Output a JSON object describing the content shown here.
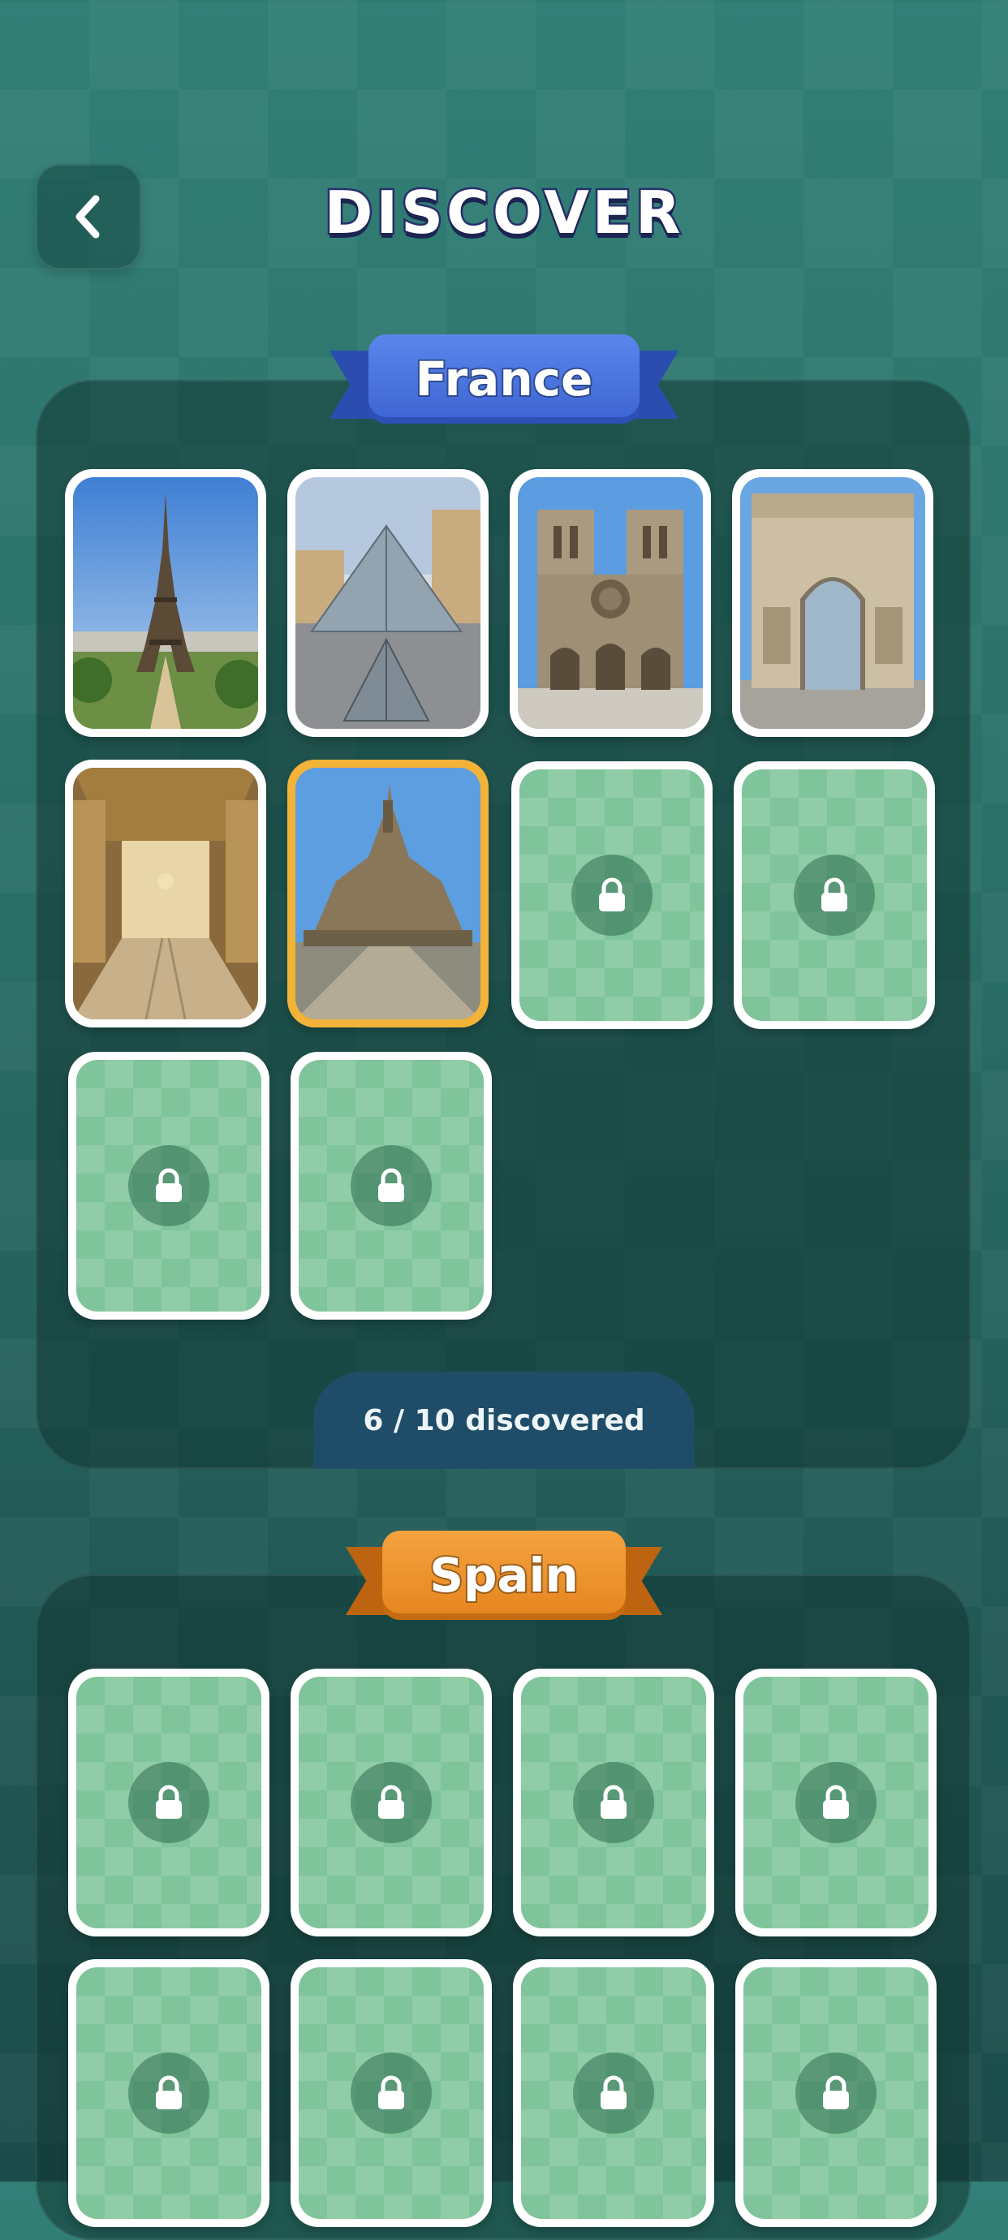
{
  "header": {
    "title": "DISCOVER",
    "back_icon": "chevron-left-icon"
  },
  "sections": [
    {
      "name": "France",
      "ribbon_color": "#3d64d2",
      "progress_text": "6 / 10 discovered",
      "cards": [
        {
          "status": "discovered",
          "subject": "eiffel-tower"
        },
        {
          "status": "discovered",
          "subject": "louvre-pyramid"
        },
        {
          "status": "discovered",
          "subject": "notre-dame"
        },
        {
          "status": "discovered",
          "subject": "arc-de-triomphe"
        },
        {
          "status": "discovered",
          "subject": "hall-of-mirrors"
        },
        {
          "status": "discovered",
          "subject": "mont-saint-michel",
          "highlighted": true
        },
        {
          "status": "locked"
        },
        {
          "status": "locked"
        },
        {
          "status": "locked"
        },
        {
          "status": "locked"
        }
      ]
    },
    {
      "name": "Spain",
      "ribbon_color": "#e5841d",
      "cards": [
        {
          "status": "locked"
        },
        {
          "status": "locked"
        },
        {
          "status": "locked"
        },
        {
          "status": "locked"
        },
        {
          "status": "locked"
        },
        {
          "status": "locked"
        },
        {
          "status": "locked"
        },
        {
          "status": "locked"
        }
      ]
    }
  ],
  "colors": {
    "locked_card": "#7fc49a",
    "highlight_border": "#f2b338",
    "counter_bg": "#1f4d69"
  },
  "icons": {
    "lock": "lock-icon"
  }
}
